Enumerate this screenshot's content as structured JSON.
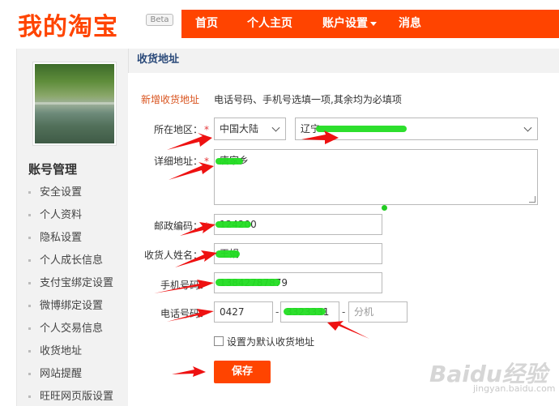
{
  "header": {
    "logo": "我的淘宝",
    "beta": "Beta",
    "nav": [
      {
        "label": "首页"
      },
      {
        "label": "个人主页"
      },
      {
        "label": "账户设置"
      },
      {
        "label": "消息"
      }
    ],
    "accent_color": "#ff4400"
  },
  "sidebar": {
    "section_title": "账号管理",
    "items": [
      {
        "label": "安全设置"
      },
      {
        "label": "个人资料"
      },
      {
        "label": "隐私设置"
      },
      {
        "label": "个人成长信息"
      },
      {
        "label": "支付宝绑定设置"
      },
      {
        "label": "微博绑定设置"
      },
      {
        "label": "个人交易信息"
      },
      {
        "label": "收货地址"
      },
      {
        "label": "网站提醒"
      },
      {
        "label": "旺旺网页版设置"
      }
    ]
  },
  "main": {
    "title": "收货地址",
    "tab_new": "新增收货地址",
    "hint": "电话号码、手机号选填一项,其余均为必填项",
    "form": {
      "region_label": "所在地区：",
      "country_value": "中国大陆",
      "province_value": "辽宁",
      "address_label": "详细地址：",
      "address_value": "唐家乡",
      "zip_label": "邮政编码：",
      "zip_value": "124200",
      "name_label": "收货人姓名：",
      "name_value": "王娟",
      "mobile_label": "手机号码：",
      "mobile_value": "13842787879",
      "phone_label": "电话号码：",
      "phone_area_value": "0427",
      "phone_number_value": "3323331",
      "phone_ext_placeholder": "分机",
      "default_label": "设置为默认收货地址",
      "required_mark": "*",
      "save_label": "保存",
      "dash": "-"
    }
  },
  "watermark": {
    "text": "Baidu经验",
    "sub": "jingyan.baidu.com"
  }
}
